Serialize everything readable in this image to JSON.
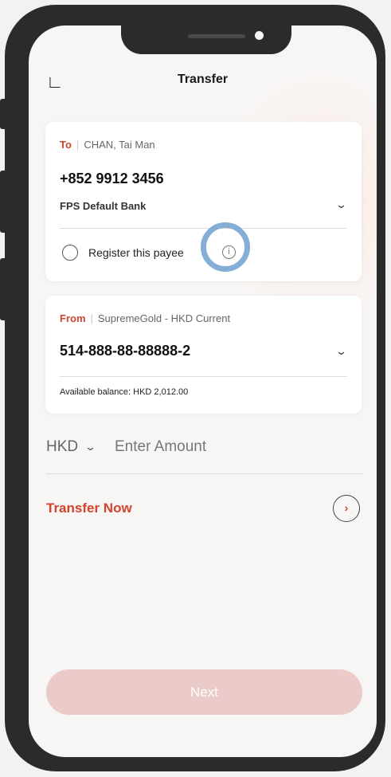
{
  "header": {
    "back_icon": "back-arrow-icon",
    "title": "Transfer"
  },
  "to_card": {
    "label": "To",
    "payee_name": "CHAN, Tai Man",
    "phone": "+852 9912 3456",
    "bank": "FPS Default Bank",
    "register_label": "Register this payee",
    "register_checked": false
  },
  "from_card": {
    "label": "From",
    "account_name": "SupremeGold - HKD Current",
    "account_number": "514-888-88-88888-2",
    "balance": "Available balance: HKD 2,012.00"
  },
  "amount": {
    "currency": "HKD",
    "placeholder": "Enter Amount"
  },
  "transfer_now": {
    "label": "Transfer Now"
  },
  "next_button": {
    "label": "Next"
  },
  "colors": {
    "accent": "#d2442e",
    "next_disabled": "#ebcaca",
    "highlight_ring": "#78a5d2"
  }
}
